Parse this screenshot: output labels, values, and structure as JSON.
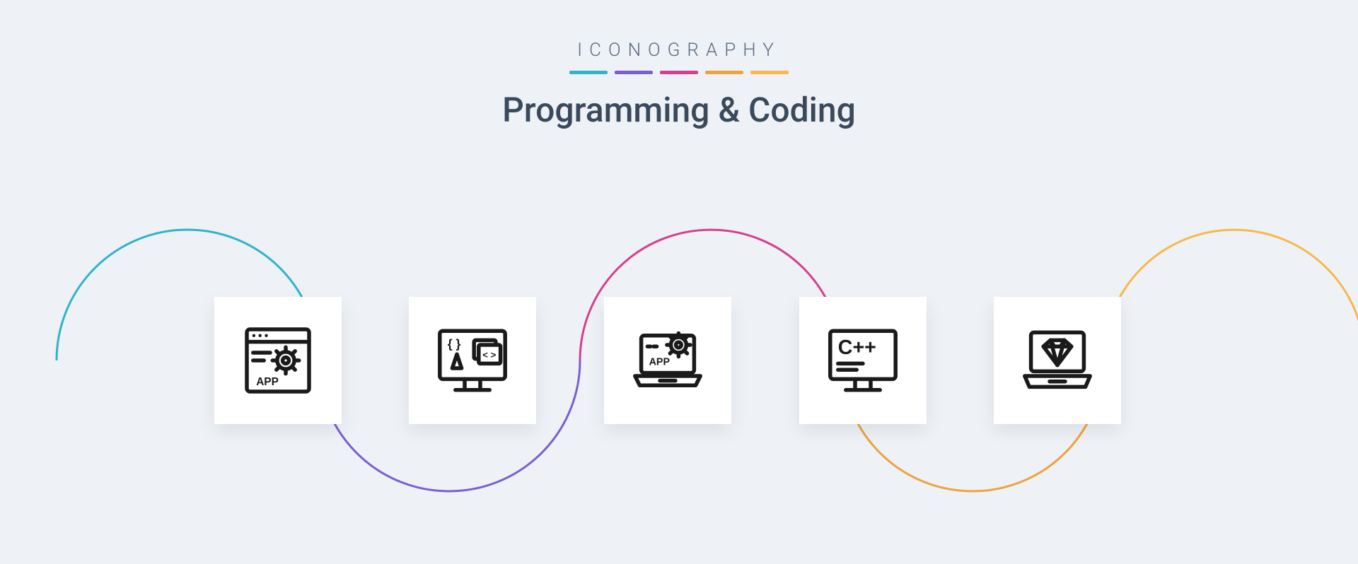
{
  "header": {
    "brand": "ICONOGRAPHY",
    "title": "Programming & Coding",
    "bar_colors": [
      "#2fb4c8",
      "#7a5fd3",
      "#d63f8e",
      "#f0a23c",
      "#f8b84a"
    ]
  },
  "colors": {
    "bg": "#eef1f6",
    "text_dark": "#3a4a5c",
    "tile": "#ffffff",
    "ink": "#1a1a1a",
    "arcs": [
      "#2fb4c8",
      "#7a5fd3",
      "#d63f8e",
      "#f0a23c",
      "#f8b84a"
    ]
  },
  "icons": [
    {
      "name": "app-window-gear-icon",
      "label_text": "APP"
    },
    {
      "name": "monitor-code-layers-icon"
    },
    {
      "name": "laptop-app-gear-icon",
      "label_text": "APP"
    },
    {
      "name": "monitor-cpp-icon",
      "label_text": "C++"
    },
    {
      "name": "laptop-diamond-icon"
    }
  ]
}
